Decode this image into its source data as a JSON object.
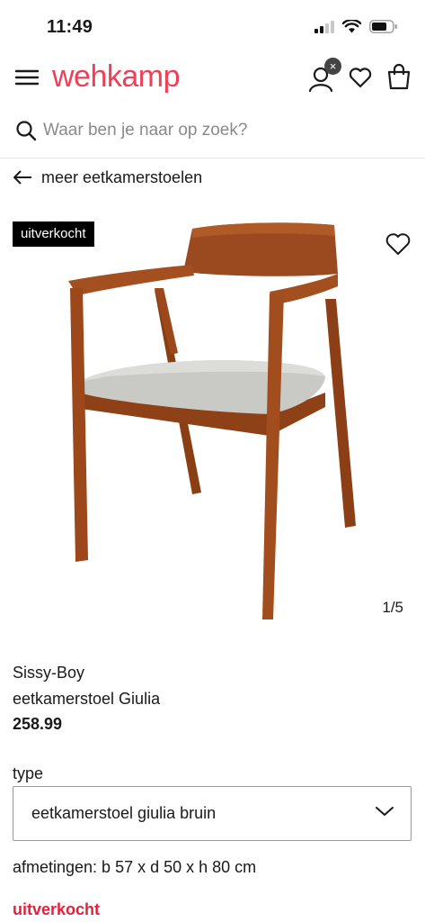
{
  "status_bar": {
    "time": "11:49"
  },
  "header": {
    "logo_text": "wehkamp",
    "account_badge": "×",
    "brand_color": "#ee4057"
  },
  "search": {
    "placeholder": "Waar ben je naar op zoek?"
  },
  "back_link": {
    "label": "meer eetkamerstoelen"
  },
  "gallery": {
    "badge": "uitverkocht",
    "counter": "1/5"
  },
  "product": {
    "brand": "Sissy-Boy",
    "name": "eetkamerstoel Giulia",
    "price": "258.99",
    "type_label": "type",
    "type_selected": "eetkamerstoel giulia bruin",
    "dimensions": "afmetingen: b 57 x d 50 x h 80 cm",
    "availability": "uitverkocht",
    "availability_color": "#e5203d"
  },
  "icons": [
    "signal-icon",
    "wifi-icon",
    "battery-icon",
    "menu-icon",
    "account-icon",
    "heart-icon",
    "bag-icon",
    "search-icon",
    "arrow-left-icon",
    "chevron-down-icon"
  ]
}
